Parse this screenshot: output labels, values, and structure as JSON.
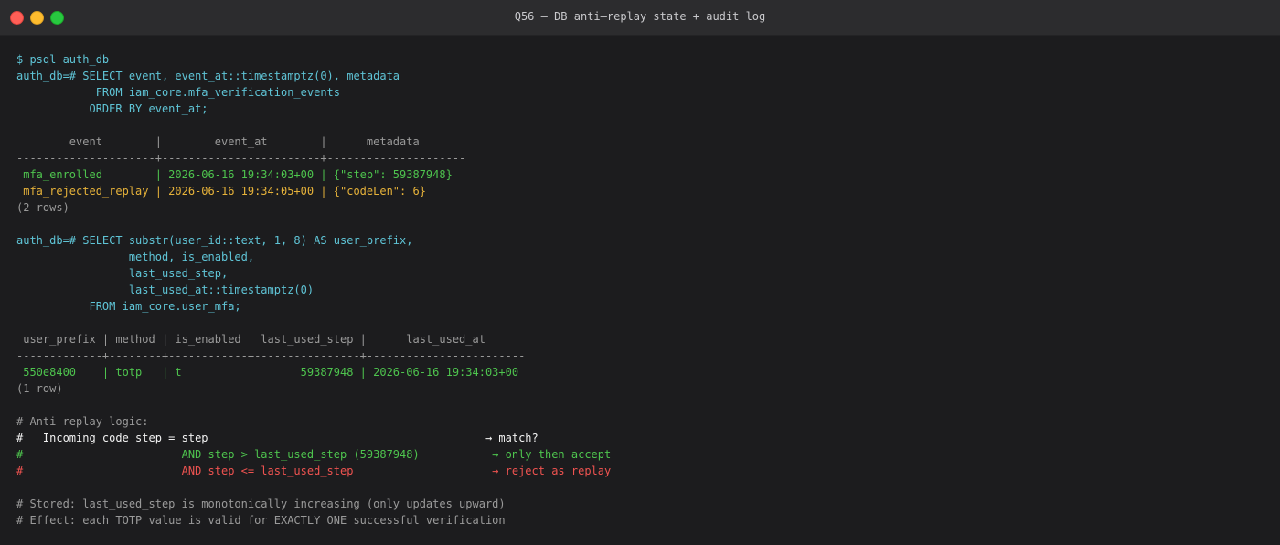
{
  "window": {
    "title": "Q56 — DB anti–replay state + audit log"
  },
  "colors": {
    "prompt": "#5fc4d6",
    "muted": "#9a9a9a",
    "ok": "#4ec44e",
    "warn": "#e6b23a",
    "error": "#ef5350"
  },
  "terminal": {
    "lines": [
      {
        "text": "$ psql auth_db",
        "color": "cyan"
      },
      {
        "text": "auth_db=# SELECT event, event_at::timestamptz(0), metadata",
        "color": "cyan"
      },
      {
        "text": "            FROM iam_core.mfa_verification_events",
        "color": "cyan"
      },
      {
        "text": "           ORDER BY event_at;",
        "color": "cyan"
      },
      {
        "text": "",
        "color": "gray"
      },
      {
        "text": "        event        |        event_at        |      metadata",
        "color": "gray"
      },
      {
        "text": "---------------------+------------------------+---------------------",
        "color": "gray"
      },
      {
        "text": " mfa_enrolled        | 2026-06-16 19:34:03+00 | {\"step\": 59387948}",
        "color": "green"
      },
      {
        "text": " mfa_rejected_replay | 2026-06-16 19:34:05+00 | {\"codeLen\": 6}",
        "color": "yellow"
      },
      {
        "text": "(2 rows)",
        "color": "gray"
      },
      {
        "text": "",
        "color": "gray"
      },
      {
        "text": "auth_db=# SELECT substr(user_id::text, 1, 8) AS user_prefix,",
        "color": "cyan"
      },
      {
        "text": "                 method, is_enabled,",
        "color": "cyan"
      },
      {
        "text": "                 last_used_step,",
        "color": "cyan"
      },
      {
        "text": "                 last_used_at::timestamptz(0)",
        "color": "cyan"
      },
      {
        "text": "           FROM iam_core.user_mfa;",
        "color": "cyan"
      },
      {
        "text": "",
        "color": "gray"
      },
      {
        "text": " user_prefix | method | is_enabled | last_used_step |      last_used_at",
        "color": "gray"
      },
      {
        "text": "-------------+--------+------------+----------------+------------------------",
        "color": "gray"
      },
      {
        "text": " 550e8400    | totp   | t          |       59387948 | 2026-06-16 19:34:03+00",
        "color": "green"
      },
      {
        "text": "(1 row)",
        "color": "gray"
      },
      {
        "text": "",
        "color": "gray"
      },
      {
        "text": "# Anti-replay logic:",
        "color": "gray"
      },
      {
        "text": "#   Incoming code step = step                                          → match?",
        "color": "white"
      },
      {
        "text": "#                        AND step > last_used_step (59387948)           → only then accept",
        "color": "green"
      },
      {
        "text": "#                        AND step <= last_used_step                     → reject as replay",
        "color": "red"
      },
      {
        "text": "",
        "color": "gray"
      },
      {
        "text": "# Stored: last_used_step is monotonically increasing (only updates upward)",
        "color": "gray"
      },
      {
        "text": "# Effect: each TOTP value is valid for EXACTLY ONE successful verification",
        "color": "gray"
      }
    ]
  }
}
